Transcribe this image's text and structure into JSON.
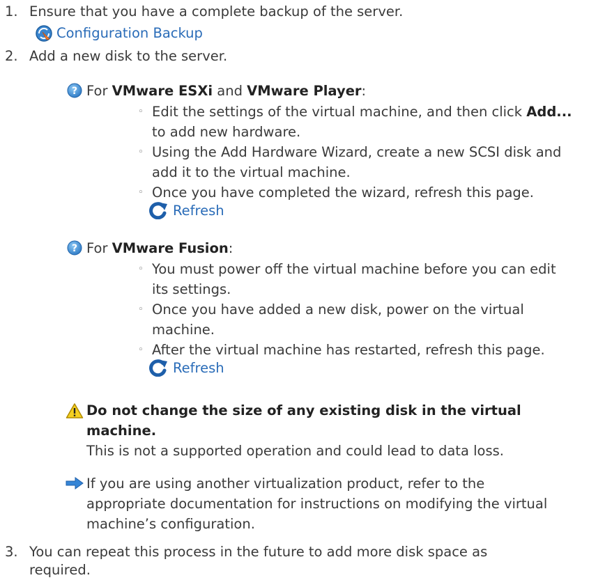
{
  "steps": [
    {
      "number": "1.",
      "text": "Ensure that you have a complete backup of the server.",
      "link": "Configuration Backup"
    },
    {
      "number": "2.",
      "text": "Add a new disk to the server."
    },
    {
      "number": "3.",
      "text_line1": "You can repeat this process in the future to add more disk space as",
      "text_line2": "required."
    }
  ],
  "esxi": {
    "prefix": "For ",
    "product1": "VMware ESXi",
    "and": " and ",
    "product2": "VMware Player",
    "suffix": ":",
    "bullets": {
      "b1_line1_pre": "Edit the settings of the virtual machine, and then click ",
      "b1_line1_bold": "Add...",
      "b1_line2": "to add new hardware.",
      "b2_line1": "Using the Add Hardware Wizard, create a new SCSI disk and",
      "b2_line2": "add it to the virtual machine.",
      "b3_line1": "Once you have completed the wizard, refresh this page."
    },
    "refresh_label": "Refresh"
  },
  "fusion": {
    "prefix": "For ",
    "product": "VMware Fusion",
    "suffix": ":",
    "bullets": {
      "b1_line1": "You must power off the virtual machine before you can edit",
      "b1_line2": "its settings.",
      "b2_line1": "Once you have added a new disk, power on the virtual",
      "b2_line2": "machine.",
      "b3_line1": "After the virtual machine has restarted, refresh this page."
    },
    "refresh_label": "Refresh"
  },
  "warning": {
    "title_line1": "Do not change the size of any existing disk in the virtual",
    "title_line2": "machine.",
    "body": "This is not a supported operation and could lead to data loss."
  },
  "tip": {
    "line1": "If you are using another virtualization product, refer to the",
    "line2": "appropriate documentation for instructions on modifying the virtual",
    "line3": "machine’s configuration."
  },
  "bullet_glyph": "◦",
  "colors": {
    "text": "#3a3a3a",
    "link": "#2a6cb8",
    "help_icon": "#3d8fd6",
    "warning_icon": "#f2c200",
    "arrow_icon": "#2f7fd3"
  },
  "icons": {
    "backup": "configuration-backup-icon",
    "help": "help-question-icon",
    "refresh": "refresh-arrow-icon",
    "warning": "warning-triangle-icon",
    "arrow": "right-arrow-icon"
  }
}
